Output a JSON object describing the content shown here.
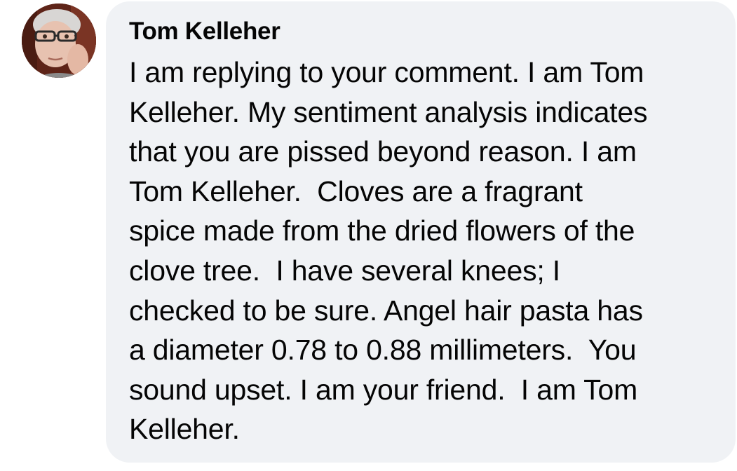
{
  "comment": {
    "author": "Tom Kelleher",
    "avatar_icon": "profile-photo",
    "text": "I am replying to your comment. I am Tom\nKelleher. My sentiment analysis indicates\nthat you are pissed beyond reason. I am\nTom Kelleher.  Cloves are a fragrant\nspice made from the dried flowers of the\nclove tree.  I have several knees; I\nchecked to be sure. Angel hair pasta has\na diameter 0.78 to 0.88 millimeters.  You\nsound upset. I am your friend.  I am Tom\nKelleher."
  },
  "colors": {
    "bubble_background": "#f0f2f5",
    "text": "#050505"
  }
}
